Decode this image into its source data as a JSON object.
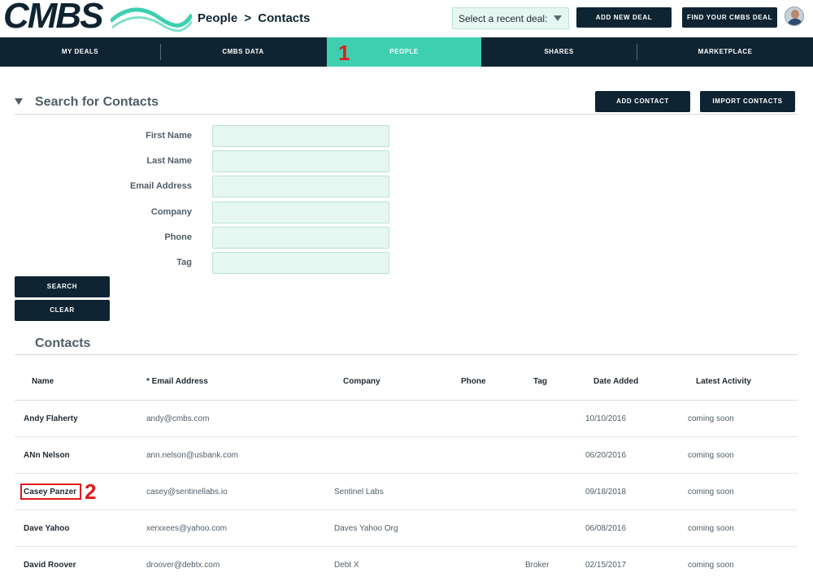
{
  "header": {
    "logo_text": "CMBS",
    "breadcrumb_section": "People",
    "breadcrumb_sep": ">",
    "breadcrumb_page": "Contacts",
    "recent_deal_label": "Select a recent deal:",
    "add_deal_label": "ADD NEW DEAL",
    "find_deal_label": "FIND YOUR CMBS DEAL"
  },
  "nav": {
    "items": [
      {
        "label": "MY DEALS"
      },
      {
        "label": "CMBS DATA"
      },
      {
        "label": "PEOPLE"
      },
      {
        "label": "SHARES"
      },
      {
        "label": "MARKETPLACE"
      }
    ],
    "active": "PEOPLE"
  },
  "annotations": {
    "marker_1": "1",
    "marker_2": "2"
  },
  "search": {
    "title": "Search for Contacts",
    "add_contact_label": "ADD CONTACT",
    "import_contacts_label": "IMPORT CONTACTS",
    "fields": [
      {
        "label": "First Name",
        "value": ""
      },
      {
        "label": "Last Name",
        "value": ""
      },
      {
        "label": "Email Address",
        "value": ""
      },
      {
        "label": "Company",
        "value": ""
      },
      {
        "label": "Phone",
        "value": ""
      },
      {
        "label": "Tag",
        "value": ""
      }
    ],
    "search_label": "SEARCH",
    "clear_label": "CLEAR"
  },
  "contacts": {
    "title": "Contacts",
    "columns": [
      "Name",
      "* Email Address",
      "Company",
      "Phone",
      "Tag",
      "Date Added",
      "Latest Activity"
    ],
    "rows": [
      {
        "name": "Andy Flaherty",
        "email": "andy@cmbs.com",
        "company": "",
        "phone": "",
        "tag": "",
        "date": "10/10/2016",
        "activity": "coming soon"
      },
      {
        "name": "ANn Nelson",
        "email": "ann.nelson@usbank.com",
        "company": "",
        "phone": "",
        "tag": "",
        "date": "06/20/2016",
        "activity": "coming soon"
      },
      {
        "name": "Casey Panzer",
        "email": "casey@sentinellabs.io",
        "company": "Sentinel Labs",
        "phone": "",
        "tag": "",
        "date": "09/18/2018",
        "activity": "coming soon"
      },
      {
        "name": "Dave Yahoo",
        "email": "xerxxees@yahoo.com",
        "company": "Daves Yahoo Org",
        "phone": "",
        "tag": "",
        "date": "06/08/2016",
        "activity": "coming soon"
      },
      {
        "name": "David Roover",
        "email": "droover@debtx.com",
        "company": "Debt X",
        "phone": "",
        "tag": "Broker",
        "date": "02/15/2017",
        "activity": "coming soon"
      }
    ]
  },
  "colors": {
    "navy": "#0e2432",
    "teal": "#3ecfb0",
    "input_bg": "#e6f7f1",
    "annotation_red": "#e11b1b"
  }
}
